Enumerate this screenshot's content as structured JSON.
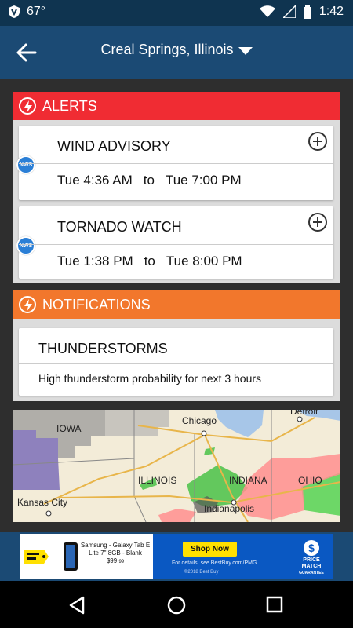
{
  "status_bar": {
    "temperature": "67°",
    "time": "1:42"
  },
  "header": {
    "location": "Creal Springs, Illinois"
  },
  "alerts": {
    "title": "ALERTS",
    "color": "#f02c33",
    "items": [
      {
        "badge": "NWS",
        "name": "WIND ADVISORY",
        "start": "Tue 4:36 AM",
        "to": "to",
        "end": "Tue 7:00 PM"
      },
      {
        "badge": "NWS",
        "name": "TORNADO WATCH",
        "start": "Tue 1:38 PM",
        "to": "to",
        "end": "Tue 8:00 PM"
      }
    ]
  },
  "notifications": {
    "title": "NOTIFICATIONS",
    "color": "#f2772c",
    "item": {
      "name": "THUNDERSTORMS",
      "detail": "High thunderstorm probability for next 3 hours"
    }
  },
  "map": {
    "labels": {
      "detroit": "Detroit",
      "chicago": "Chicago",
      "iowa": "IOWA",
      "illinois": "ILLINOIS",
      "indiana": "INDIANA",
      "ohio": "OHIO",
      "indianapolis": "Indianapolis",
      "kansas_city": "Kansas City"
    }
  },
  "ad": {
    "product": "Samsung - Galaxy Tab E Lite 7\" 8GB - Blank",
    "price": "$99",
    "price_cents": "99",
    "cta": "Shop Now",
    "fine_print": "For details, see BestBuy.com/PMG",
    "copyright": "©2018 Best Buy",
    "price_match_1": "PRICE MATCH",
    "price_match_2": "GUARANTEE"
  },
  "colors": {
    "status_bar": "#0f3450",
    "app_bar": "#1b4a74",
    "background": "#2e2e2e",
    "nws_badge": "#2b7fd6",
    "ad_blue": "#0a58c2"
  }
}
